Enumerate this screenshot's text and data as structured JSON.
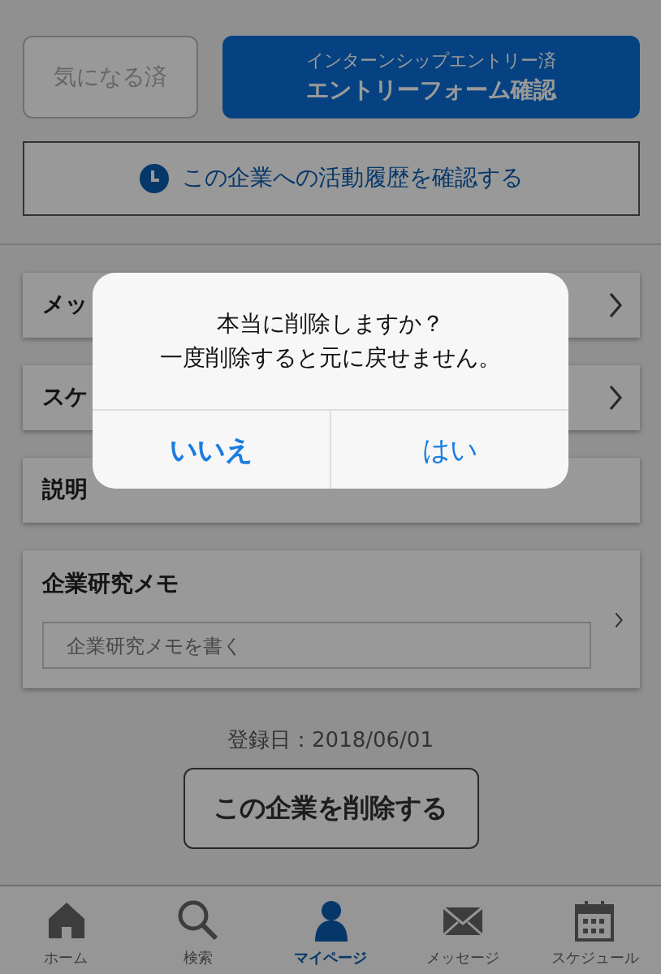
{
  "actions": {
    "interest_button": {
      "label": "気になる済",
      "disabled": true
    },
    "entry_button": {
      "sublabel": "インターンシップエントリー済",
      "label": "エントリーフォーム確認"
    },
    "history_button": {
      "label": "この企業への活動履歴を確認する"
    }
  },
  "cards": [
    {
      "kind": "link",
      "title": "メッ"
    },
    {
      "kind": "link",
      "title": "スケ"
    },
    {
      "kind": "plain",
      "title": "説明"
    },
    {
      "kind": "memo",
      "title": "企業研究メモ",
      "placeholder": "企業研究メモを書く"
    }
  ],
  "registered": "登録日：2018/06/01",
  "delete_button": "この企業を削除する",
  "tabs": [
    {
      "label": "ホーム",
      "kind": "home",
      "selected": false
    },
    {
      "label": "検索",
      "kind": "search",
      "selected": false
    },
    {
      "label": "マイページ",
      "kind": "person",
      "selected": true
    },
    {
      "label": "メッセージ",
      "kind": "mail",
      "selected": false
    },
    {
      "label": "スケジュール",
      "kind": "calendar",
      "selected": false
    }
  ],
  "dialog": {
    "message_lines": [
      "本当に削除しますか？",
      "一度削除すると元に戻せません。"
    ],
    "buttons": [
      {
        "label": "いいえ",
        "bold": true
      },
      {
        "label": "はい",
        "bold": false
      }
    ]
  }
}
